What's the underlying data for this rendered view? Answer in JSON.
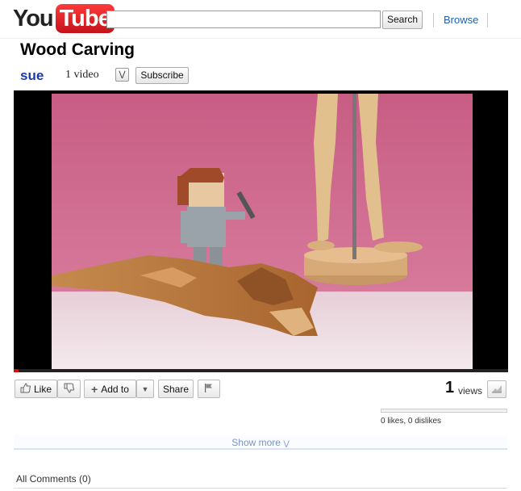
{
  "header": {
    "logo_you": "You",
    "logo_tube": "Tube",
    "search_value": "",
    "search_button": "Search",
    "browse": "Browse"
  },
  "video": {
    "title": "Wood Carving",
    "channel": "sue",
    "video_count": "1 video",
    "subscribe": "Subscribe",
    "progress_fraction": 0.01
  },
  "actions": {
    "like": "Like",
    "add_to": "Add to",
    "share": "Share"
  },
  "stats": {
    "views_count": "1",
    "views_label": "views",
    "likes_summary": "0 likes, 0 dislikes"
  },
  "show_more": "Show more",
  "comments": "All Comments (0)",
  "colors": {
    "logo_red": "#e01e1e",
    "link_blue": "#1b5fb5",
    "channel_blue": "#1b3aa8",
    "progress_red": "#cc1111"
  },
  "icons": [
    "thumb-up-icon",
    "thumb-down-icon",
    "plus-icon",
    "dropdown-arrow-icon",
    "flag-icon",
    "stats-chart-icon",
    "chevron-down-icon",
    "expand-icon"
  ]
}
